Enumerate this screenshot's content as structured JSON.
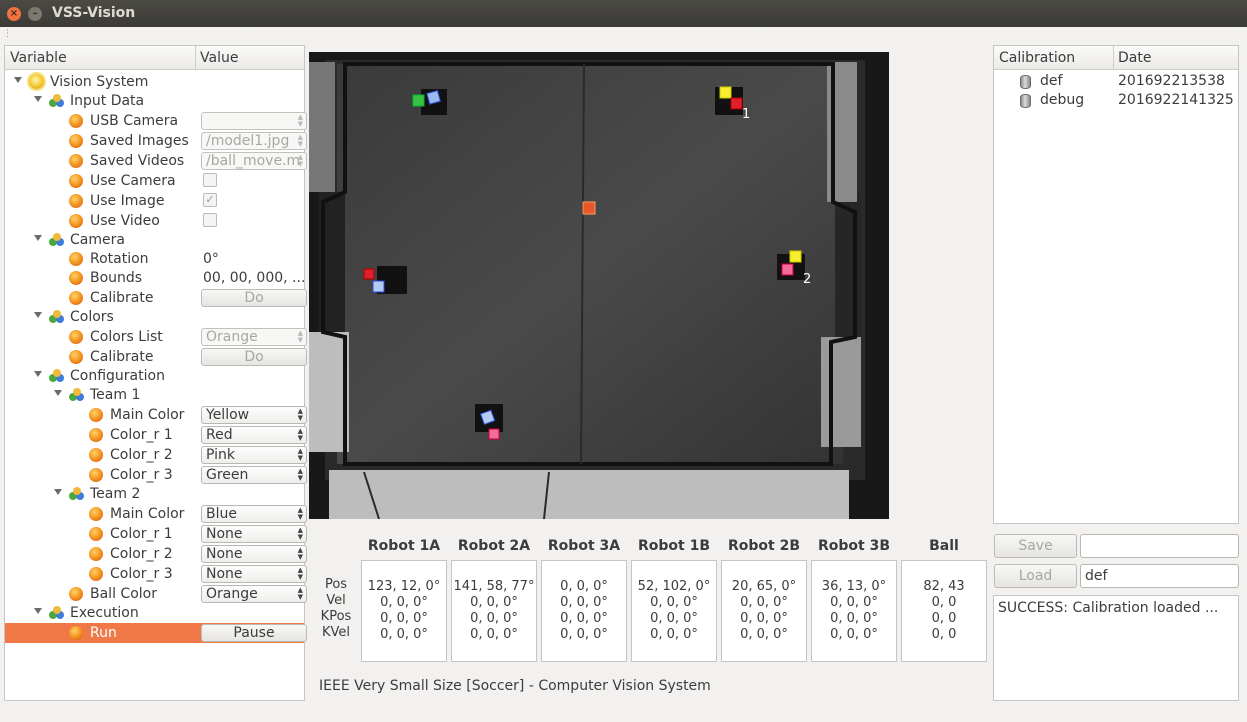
{
  "window": {
    "title": "VSS-Vision"
  },
  "tree": {
    "col_variable": "Variable",
    "col_value": "Value",
    "root": "Vision System",
    "input_data": {
      "label": "Input Data",
      "usb_camera": {
        "label": "USB Camera",
        "value": ""
      },
      "saved_images": {
        "label": "Saved Images",
        "value": "/model1.jpg"
      },
      "saved_videos": {
        "label": "Saved Videos",
        "value": "/ball_move.m"
      },
      "use_camera": {
        "label": "Use Camera",
        "checked": false
      },
      "use_image": {
        "label": "Use Image",
        "checked": true,
        "mark": "✓"
      },
      "use_video": {
        "label": "Use Video",
        "checked": false
      }
    },
    "camera": {
      "label": "Camera",
      "rotation": {
        "label": "Rotation",
        "value": "0°"
      },
      "bounds": {
        "label": "Bounds",
        "value": "00, 00, 000, ..."
      },
      "calibrate": {
        "label": "Calibrate",
        "button": "Do"
      }
    },
    "colors": {
      "label": "Colors",
      "colors_list": {
        "label": "Colors List",
        "value": "Orange"
      },
      "calibrate": {
        "label": "Calibrate",
        "button": "Do"
      }
    },
    "configuration": {
      "label": "Configuration",
      "team1": {
        "label": "Team 1",
        "main_color": {
          "label": "Main Color",
          "value": "Yellow"
        },
        "color_r1": {
          "label": "Color_r 1",
          "value": "Red"
        },
        "color_r2": {
          "label": "Color_r 2",
          "value": "Pink"
        },
        "color_r3": {
          "label": "Color_r 3",
          "value": "Green"
        }
      },
      "team2": {
        "label": "Team 2",
        "main_color": {
          "label": "Main Color",
          "value": "Blue"
        },
        "color_r1": {
          "label": "Color_r 1",
          "value": "None"
        },
        "color_r2": {
          "label": "Color_r 2",
          "value": "None"
        },
        "color_r3": {
          "label": "Color_r 3",
          "value": "None"
        }
      },
      "ball_color": {
        "label": "Ball Color",
        "value": "Orange"
      }
    },
    "execution": {
      "label": "Execution",
      "run": {
        "label": "Run",
        "button": "Pause"
      }
    }
  },
  "field": {
    "robot_labels": [
      "1",
      "2"
    ]
  },
  "robots": {
    "row_labels": [
      "Pos",
      "Vel",
      "KPos",
      "KVel"
    ],
    "columns": [
      {
        "name": "Robot 1A",
        "pos": "123, 12, 0°",
        "vel": "0, 0, 0°",
        "kpos": "0, 0, 0°",
        "kvel": "0, 0, 0°"
      },
      {
        "name": "Robot 2A",
        "pos": "141, 58, 77°",
        "vel": "0, 0, 0°",
        "kpos": "0, 0, 0°",
        "kvel": "0, 0, 0°"
      },
      {
        "name": "Robot 3A",
        "pos": "0, 0, 0°",
        "vel": "0, 0, 0°",
        "kpos": "0, 0, 0°",
        "kvel": "0, 0, 0°"
      },
      {
        "name": "Robot 1B",
        "pos": "52, 102, 0°",
        "vel": "0, 0, 0°",
        "kpos": "0, 0, 0°",
        "kvel": "0, 0, 0°"
      },
      {
        "name": "Robot 2B",
        "pos": "20, 65, 0°",
        "vel": "0, 0, 0°",
        "kpos": "0, 0, 0°",
        "kvel": "0, 0, 0°"
      },
      {
        "name": "Robot 3B",
        "pos": "36, 13, 0°",
        "vel": "0, 0, 0°",
        "kpos": "0, 0, 0°",
        "kvel": "0, 0, 0°"
      },
      {
        "name": "Ball",
        "pos": "82, 43",
        "vel": "0, 0",
        "kpos": "0, 0",
        "kvel": "0, 0"
      }
    ]
  },
  "footer": "IEEE Very Small Size [Soccer]  -  Computer Vision System",
  "calibration": {
    "col_calibration": "Calibration",
    "col_date": "Date",
    "items": [
      {
        "name": "def",
        "date": "201692213538"
      },
      {
        "name": "debug",
        "date": "2016922141325"
      }
    ],
    "save_button": "Save",
    "save_input": "",
    "load_button": "Load",
    "load_input": "def",
    "log": "SUCCESS: Calibration loaded ..."
  },
  "colors": {
    "selection": "#f07746",
    "titlebar": "#3b3a36",
    "close_button": "#f0723f"
  }
}
